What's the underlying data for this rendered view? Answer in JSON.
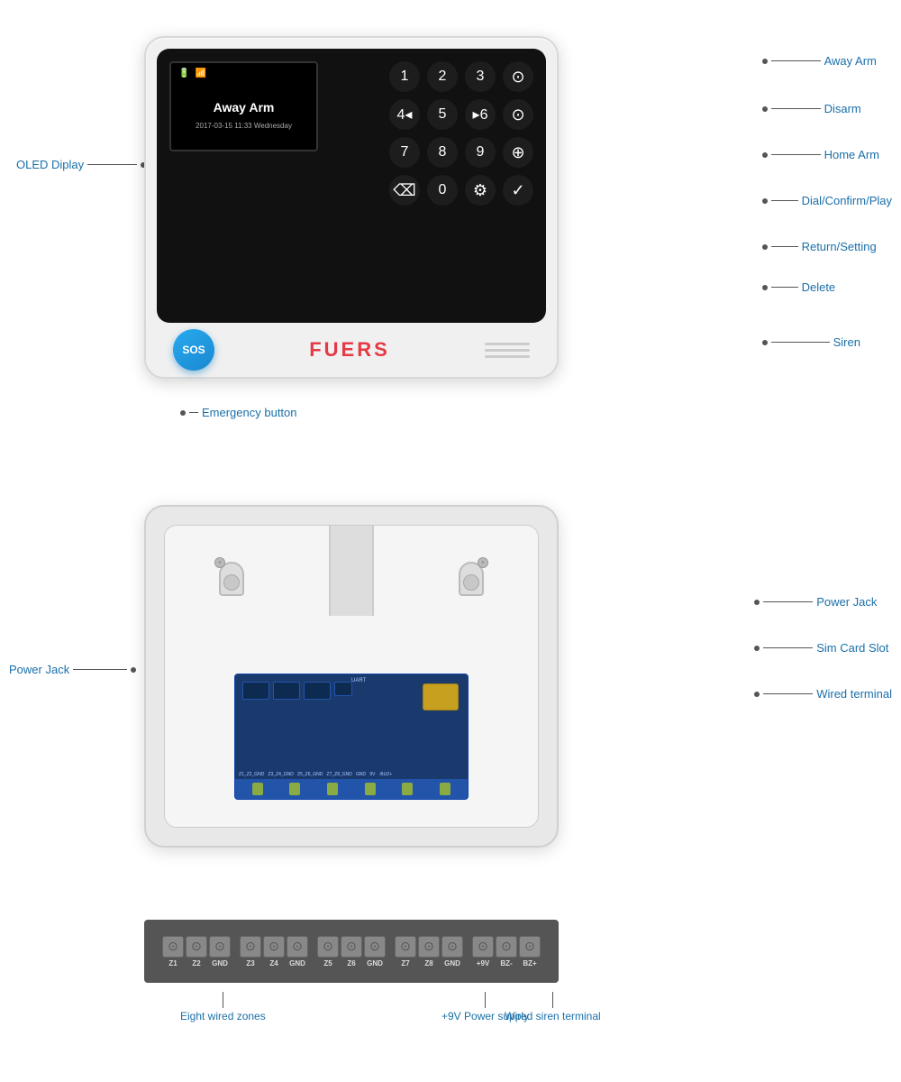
{
  "device": {
    "brand": "FUERS",
    "oled": {
      "status": "Away Arm",
      "datetime": "2017-03-15   11:33  Wednesday",
      "icons": [
        "battery",
        "wifi"
      ]
    },
    "keypad": {
      "keys": [
        "1",
        "2",
        "3",
        "⊙",
        "4◂",
        "5",
        "▸6",
        "⊙",
        "7",
        "8",
        "9",
        "⊙",
        "⌫",
        "0",
        "⚙",
        "✓"
      ]
    },
    "sos_label": "SOS",
    "siren_lines": 3
  },
  "front_annotations": {
    "oled_label": "OLED Diplay",
    "away_arm": "Away Arm",
    "disarm": "Disarm",
    "home_arm": "Home Arm",
    "dial_confirm": "Dial/Confirm/Play",
    "return_setting": "Return/Setting",
    "delete": "Delete",
    "siren": "Siren",
    "emergency_button": "Emergency button"
  },
  "back_annotations": {
    "power_jack_left": "Power Jack",
    "power_jack_right": "Power Jack",
    "sim_card_slot": "Sim Card Slot",
    "wired_terminal": "Wired terminal"
  },
  "terminal": {
    "connectors": [
      {
        "label": "Z1"
      },
      {
        "label": "Z2"
      },
      {
        "label": "GND"
      },
      {
        "label": "Z3"
      },
      {
        "label": "Z4"
      },
      {
        "label": "GND"
      },
      {
        "label": "Z5"
      },
      {
        "label": "Z6"
      },
      {
        "label": "GND"
      },
      {
        "label": "Z7"
      },
      {
        "label": "Z8"
      },
      {
        "label": "GND"
      },
      {
        "label": "+9V"
      },
      {
        "label": "BZ-"
      },
      {
        "label": "BZ+"
      }
    ],
    "annotations": {
      "eight_wired_zones": "Eight wired zones",
      "plus9v_power": "+9V Power supply",
      "wired_siren": "Wired siren terminal"
    }
  }
}
